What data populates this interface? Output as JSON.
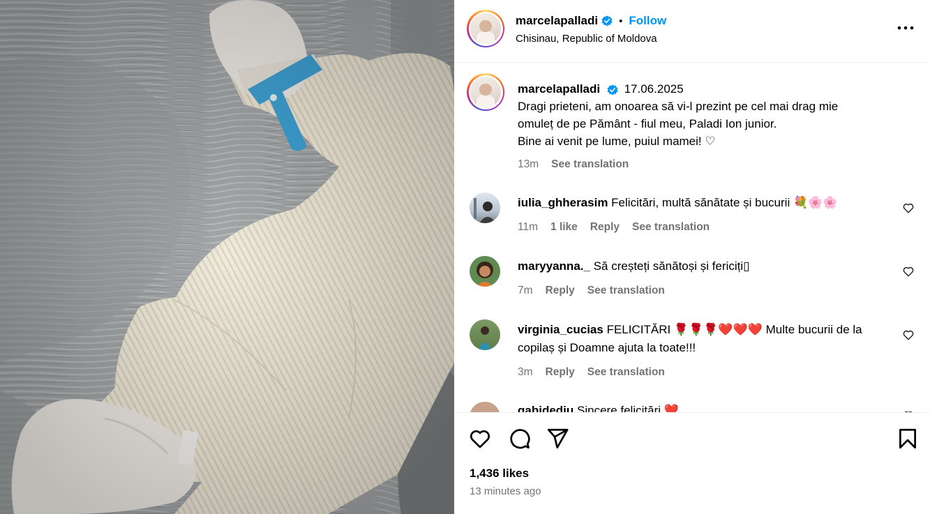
{
  "post": {
    "username": "marcelapalladi",
    "follow_label": "Follow",
    "separator": "•",
    "location": "Chisinau, Republic of Moldova"
  },
  "caption": {
    "username": "marcelapalladi",
    "date": "17.06.2025",
    "lines": [
      "Dragi prieteni, am onoarea să vi-l prezint pe cel mai drag mie",
      "omuleț de pe Pământ - fiul meu, Paladi Ion junior.",
      "Bine ai venit pe lume, puiul mamei! ♡"
    ],
    "time": "13m",
    "see_translation": "See translation"
  },
  "comments": [
    {
      "username": "iulia_ghherasim",
      "text": "Felicitări, multă sănătate și bucurii 💐🌸🌸",
      "time": "11m",
      "likes": "1 like",
      "reply": "Reply",
      "see_translation": "See translation",
      "avatar_color": "#c9d4de"
    },
    {
      "username": "maryyanna._",
      "text": "Să creșteți sănătoși și fericiți▯",
      "time": "7m",
      "reply": "Reply",
      "see_translation": "See translation",
      "avatar_color": "#4e7a45"
    },
    {
      "username": "virginia_cucias",
      "text": "FELICITĂRI 🌹🌹🌹❤️❤️❤️ Multe bucurii de la copilaș și Doamne ajuta la toate!!!",
      "time": "3m",
      "reply": "Reply",
      "see_translation": "See translation",
      "avatar_color": "#6f8a57"
    },
    {
      "username": "gabidediu",
      "text": "Sincere felicitări ❤️",
      "avatar_color": "#c9a28c"
    }
  ],
  "footer": {
    "likes": "1,436 likes",
    "time_ago": "13 minutes ago"
  },
  "colors": {
    "accent": "#0095f6",
    "muted": "#737373",
    "verified": "#0095f6"
  },
  "icons": [
    "verified-badge-icon",
    "more-options-icon",
    "heart-icon",
    "comment-icon",
    "share-icon",
    "bookmark-icon"
  ]
}
